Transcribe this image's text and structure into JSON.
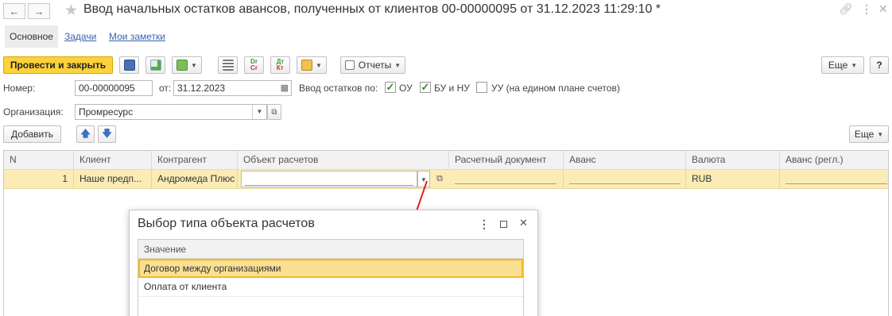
{
  "window": {
    "title": "Ввод начальных остатков авансов, полученных от клиентов 00-00000095 от 31.12.2023 11:29:10 *",
    "back_icon": "arrow-left-icon",
    "forward_icon": "arrow-right-icon",
    "star_icon": "star-icon"
  },
  "tabs": [
    {
      "label": "Основное"
    },
    {
      "label": "Задачи"
    },
    {
      "label": "Мои заметки"
    }
  ],
  "toolbar": {
    "post_close_label": "Провести и закрыть",
    "reports_label": "Отчеты",
    "more_label": "Еще",
    "help_label": "?"
  },
  "form": {
    "number_label": "Номер:",
    "number_value": "00-00000095",
    "date_label": "от:",
    "date_value": "31.12.2023",
    "input_mode_label": "Ввод остатков по:",
    "checkboxes": [
      {
        "label": "ОУ",
        "checked": true
      },
      {
        "label": "БУ и НУ",
        "checked": true
      },
      {
        "label": "УУ (на едином плане счетов)",
        "checked": false
      }
    ],
    "org_label": "Организация:",
    "org_value": "Промресурс"
  },
  "table_toolbar": {
    "add_label": "Добавить",
    "more_label": "Еще"
  },
  "table": {
    "columns": [
      "N",
      "Клиент",
      "Контрагент",
      "Объект расчетов",
      "Расчетный документ",
      "Аванс",
      "Валюта",
      "Аванс (регл.)"
    ],
    "rows": [
      {
        "n": "1",
        "client": "Наше предп...",
        "counterparty": "Андромеда Плюс",
        "object": "",
        "doc": "",
        "advance": "",
        "currency": "RUB",
        "advance_reg": ""
      }
    ]
  },
  "dialog": {
    "title": "Выбор типа объекта расчетов",
    "column": "Значение",
    "items": [
      "Договор между организациями",
      "Оплата от клиента"
    ],
    "selected_index": 0
  },
  "colors": {
    "accent_yellow": "#fbd23a",
    "row_highlight": "#fbecb6",
    "link_blue": "#3a62ad",
    "arrow_red": "#e02020"
  }
}
